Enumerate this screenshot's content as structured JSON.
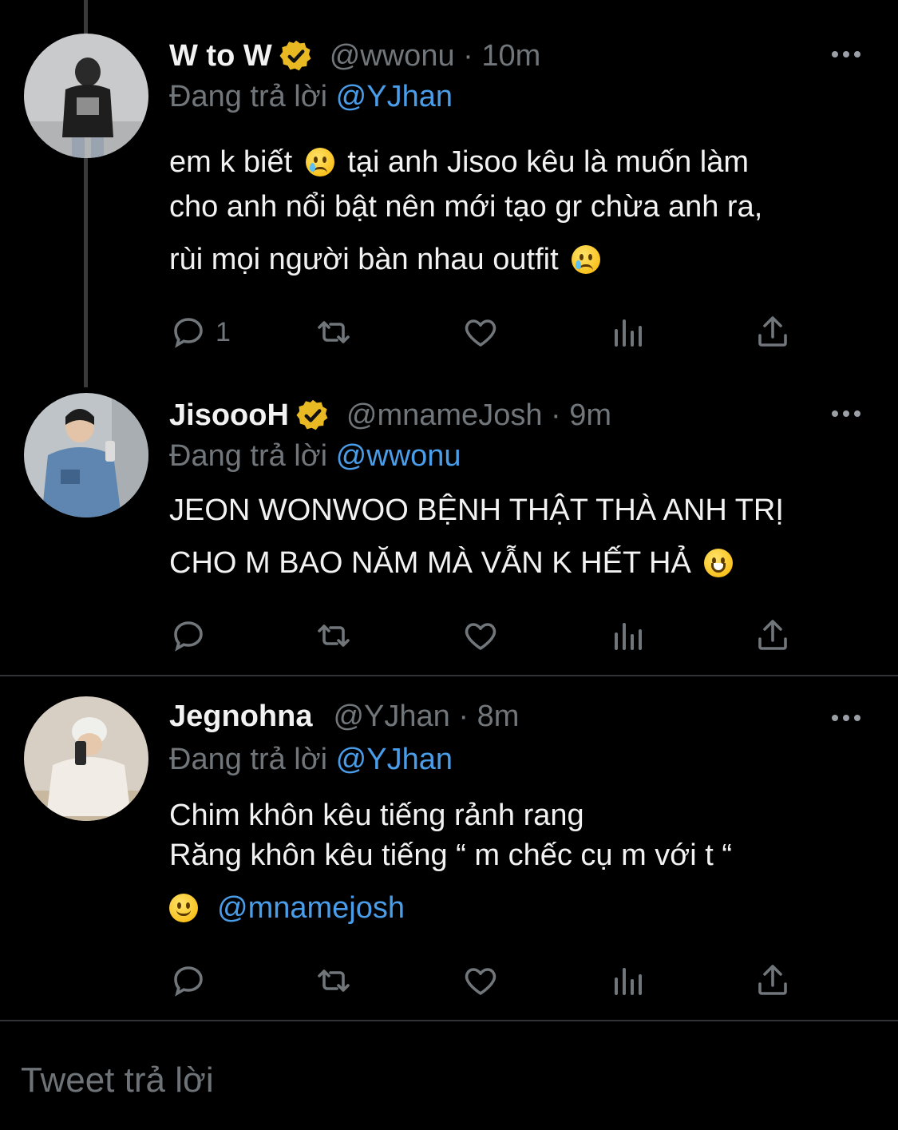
{
  "tweets": [
    {
      "name": "W to W",
      "verified": true,
      "handle": "@wwonu",
      "time": "10m",
      "replying_prefix": "Đang trả lời",
      "replying_to": "@YJhan",
      "lines": [
        [
          "em k biết ",
          "sad",
          "  tại anh Jisoo kêu là muốn làm"
        ],
        [
          "cho anh nổi bật nên mới tạo gr chừa anh ra,"
        ],
        [
          "rùi mọi người bàn nhau outfit ",
          "sad"
        ]
      ],
      "reply_count": "1"
    },
    {
      "name": "JisoooH",
      "verified": true,
      "handle": "@mnameJosh",
      "time": "9m",
      "replying_prefix": "Đang trả lời",
      "replying_to": "@wwonu",
      "lines": [
        [
          "JEON WONWOO BỆNH THẬT THÀ ANH TRỊ"
        ],
        [
          "CHO M BAO NĂM MÀ VẪN K HẾT HẢ ",
          "grin"
        ]
      ],
      "reply_count": ""
    },
    {
      "name": "Jegnohna",
      "verified": false,
      "handle": "@YJhan",
      "time": "8m",
      "replying_prefix": "Đang trả lời",
      "replying_to": "@YJhan",
      "lines": [
        [
          "Chim khôn kêu tiếng rảnh rang"
        ],
        [
          "Răng khôn kêu tiếng “ m chếc cụ m với t “"
        ]
      ],
      "mention_line": {
        "emoji": "smile",
        "mention": "@mnamejosh"
      },
      "reply_count": ""
    }
  ],
  "icons": [
    "reply-icon",
    "retweet-icon",
    "like-icon",
    "views-icon",
    "share-icon",
    "more-icon",
    "verified-icon"
  ],
  "colors": {
    "background": "#000000",
    "link": "#4a9de8",
    "muted": "#71767b",
    "verified": "#e8b923"
  },
  "composer": {
    "placeholder": "Tweet trả lời"
  }
}
